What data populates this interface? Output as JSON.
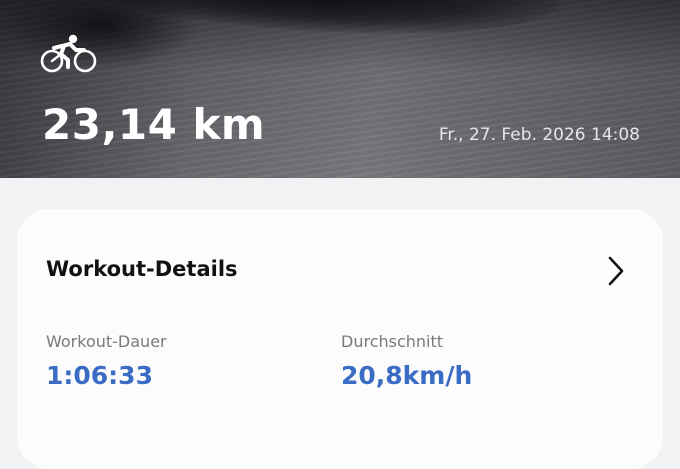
{
  "header": {
    "activity_icon": "cycling-icon",
    "distance": "23,14 km",
    "datetime": "Fr., 27. Feb. 2026 14:08"
  },
  "details_card": {
    "title": "Workout-Details",
    "chevron_icon": "chevron-right-icon",
    "stats": [
      {
        "label": "Workout-Dauer",
        "value": "1:06:33"
      },
      {
        "label": "Durchschnitt",
        "value": "20,8km/h"
      }
    ]
  },
  "colors": {
    "accent": "#3b6cc4",
    "card_bg": "#fcfcfd",
    "page_bg": "#f2f2f4"
  }
}
